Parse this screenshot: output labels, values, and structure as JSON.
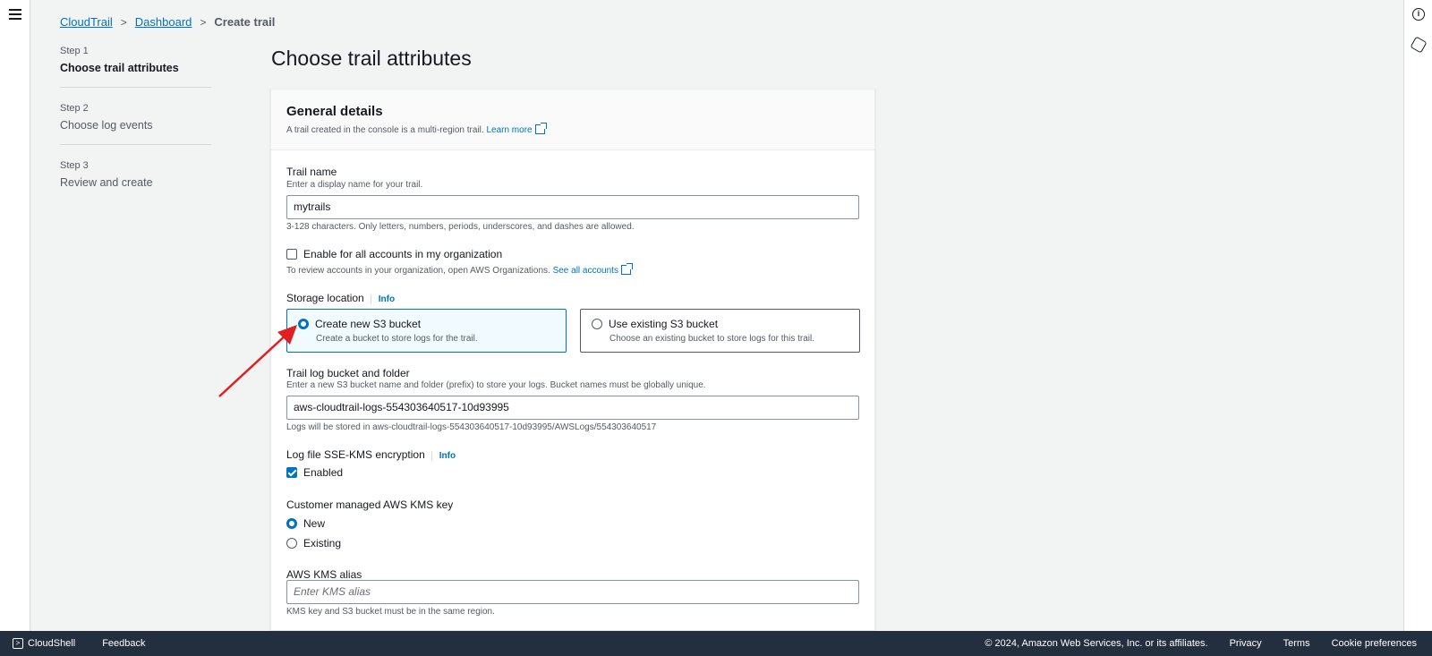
{
  "breadcrumb": {
    "items": [
      "CloudTrail",
      "Dashboard"
    ],
    "current": "Create trail"
  },
  "steps": [
    {
      "num": "Step 1",
      "title": "Choose trail attributes",
      "active": true
    },
    {
      "num": "Step 2",
      "title": "Choose log events",
      "active": false
    },
    {
      "num": "Step 3",
      "title": "Review and create",
      "active": false
    }
  ],
  "page_title": "Choose trail attributes",
  "general": {
    "title": "General details",
    "desc": "A trail created in the console is a multi-region trail.",
    "learn_more": "Learn more"
  },
  "trail_name": {
    "label": "Trail name",
    "desc": "Enter a display name for your trail.",
    "value": "mytrails",
    "constraint": "3-128 characters. Only letters, numbers, periods, underscores, and dashes are allowed."
  },
  "org": {
    "label": "Enable for all accounts in my organization",
    "checked": false,
    "desc": "To review accounts in your organization, open AWS Organizations.",
    "link": "See all accounts"
  },
  "storage": {
    "label": "Storage location",
    "info": "Info",
    "options": [
      {
        "title": "Create new S3 bucket",
        "desc": "Create a bucket to store logs for the trail.",
        "selected": true
      },
      {
        "title": "Use existing S3 bucket",
        "desc": "Choose an existing bucket to store logs for this trail.",
        "selected": false
      }
    ]
  },
  "bucket": {
    "label": "Trail log bucket and folder",
    "desc": "Enter a new S3 bucket name and folder (prefix) to store your logs. Bucket names must be globally unique.",
    "value": "aws-cloudtrail-logs-554303640517-10d93995",
    "constraint": "Logs will be stored in aws-cloudtrail-logs-554303640517-10d93995/AWSLogs/554303640517"
  },
  "kms": {
    "label": "Log file SSE-KMS encryption",
    "info": "Info",
    "enabled_label": "Enabled",
    "enabled": true
  },
  "cmk": {
    "label": "Customer managed AWS KMS key",
    "options": [
      {
        "label": "New",
        "selected": true
      },
      {
        "label": "Existing",
        "selected": false
      }
    ]
  },
  "alias": {
    "label": "AWS KMS alias",
    "placeholder": "Enter KMS alias",
    "constraint": "KMS key and S3 bucket must be in the same region."
  },
  "footer": {
    "cloudshell": "CloudShell",
    "feedback": "Feedback",
    "copyright": "© 2024, Amazon Web Services, Inc. or its affiliates.",
    "privacy": "Privacy",
    "terms": "Terms",
    "cookies": "Cookie preferences"
  },
  "colors": {
    "accent": "#0073bb",
    "annotation_arrow": "#e02020",
    "footer_bg": "#232f3e"
  }
}
